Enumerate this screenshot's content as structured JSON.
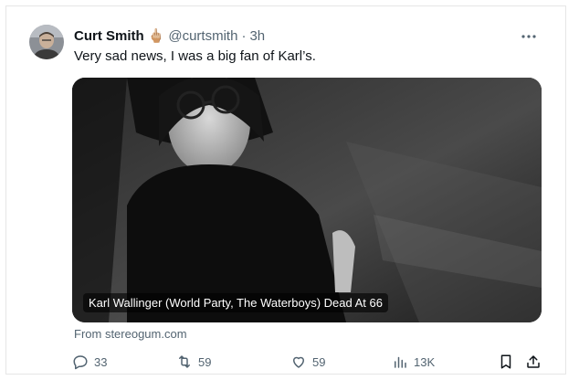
{
  "tweet": {
    "author_name": "Curt Smith",
    "author_emoji": "🖕🏼",
    "handle": "@curtsmith",
    "separator": "·",
    "time": "3h",
    "text": "Very sad news, I was a big fan of Karl’s.",
    "media_caption": "Karl Wallinger (World Party, The Waterboys) Dead At 66",
    "source": "From stereogum.com"
  },
  "actions": {
    "replies": "33",
    "reposts": "59",
    "likes": "59",
    "views": "13K"
  },
  "icons": {
    "more": "more-icon",
    "reply": "reply-icon",
    "repost": "repost-icon",
    "like": "like-icon",
    "views": "views-icon",
    "bookmark": "bookmark-icon",
    "share": "share-icon"
  },
  "colors": {
    "text": "#0f1419",
    "secondary": "#536471",
    "border": "#e6e6e6"
  }
}
